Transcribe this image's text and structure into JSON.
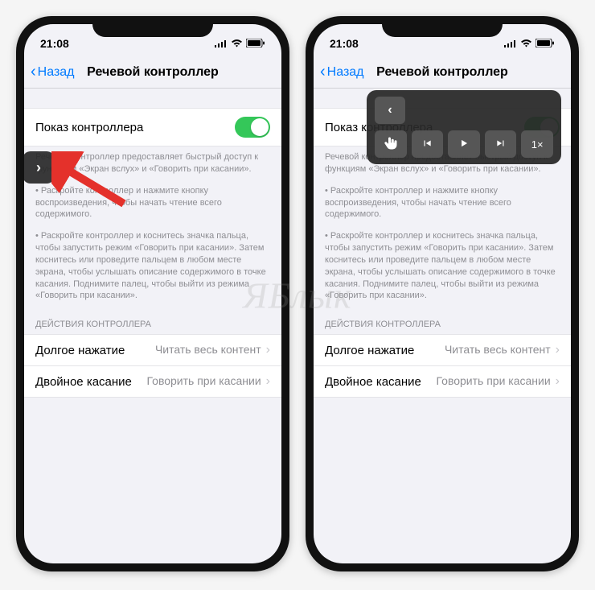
{
  "status": {
    "time": "21:08"
  },
  "nav": {
    "back": "Назад",
    "title": "Речевой контроллер"
  },
  "toggle_row": {
    "label": "Показ контроллера"
  },
  "explain1": "Речевой контроллер предоставляет быстрый доступ к функциям «Экран вслух» и «Говорить при касании».",
  "explain2": "• Раскройте контроллер и нажмите кнопку воспроизведения, чтобы начать чтение всего содержимого.",
  "explain3": "• Раскройте контроллер и коснитесь значка пальца, чтобы запустить режим «Говорить при касании». Затем коснитесь или проведите пальцем в любом месте экрана, чтобы услышать описание содержимого в точке касания. Поднимите палец, чтобы выйти из режима «Говорить при касании».",
  "section": "ДЕЙСТВИЯ КОНТРОЛЛЕРА",
  "rows": [
    {
      "label": "Долгое нажатие",
      "value": "Читать весь контент"
    },
    {
      "label": "Двойное касание",
      "value": "Говорить при касании"
    }
  ],
  "playback_rate": "1×",
  "watermark": "ЯБлык"
}
